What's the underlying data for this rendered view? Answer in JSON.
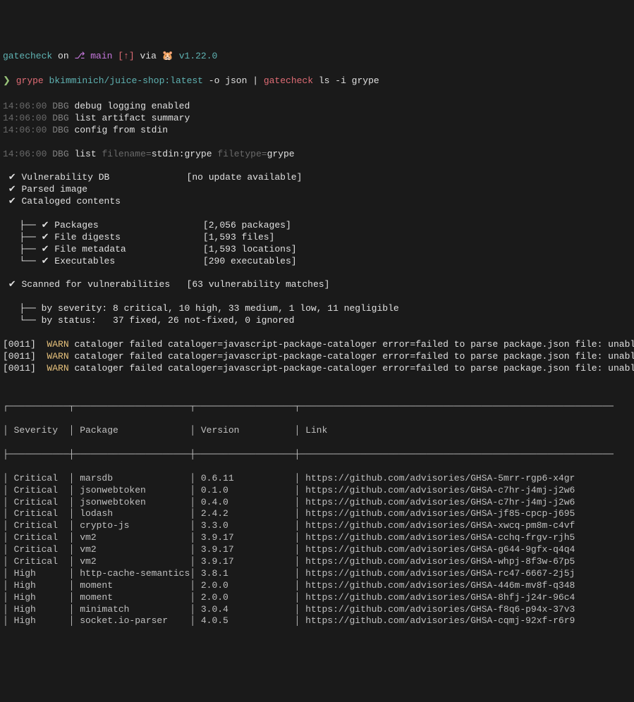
{
  "prompt": {
    "project": "gatecheck",
    "on": "on",
    "branch_icon": "⎇",
    "branch": "main",
    "branch_status": "[↑]",
    "via": "via",
    "lang_icon": "🐹",
    "version": "v1.22.0",
    "prompt_char": "❯",
    "cmd_grype": "grype",
    "cmd_image": "bkimminich/juice-shop:latest",
    "cmd_opts": "-o json |",
    "cmd_gatecheck": "gatecheck",
    "cmd_tail": "ls -i grype"
  },
  "debug": [
    {
      "ts": "14:06:00",
      "tag": "DBG",
      "msg": "debug logging enabled"
    },
    {
      "ts": "14:06:00",
      "tag": "DBG",
      "msg": "list artifact summary"
    },
    {
      "ts": "14:06:00",
      "tag": "DBG",
      "msg": "config from stdin"
    }
  ],
  "list_line": {
    "ts": "14:06:00",
    "tag": "DBG",
    "action": "list",
    "filename_key": "filename=",
    "filename_val": "stdin:grype",
    "filetype_key": "filetype=",
    "filetype_val": "grype"
  },
  "steps": [
    {
      "check": "✔",
      "label": "Vulnerability DB",
      "right": "[no update available]"
    },
    {
      "check": "✔",
      "label": "Parsed image",
      "right": ""
    },
    {
      "check": "✔",
      "label": "Cataloged contents",
      "right": ""
    }
  ],
  "catalog_items": [
    {
      "prefix": "├──",
      "check": "✔",
      "label": "Packages",
      "right": "[2,056 packages]"
    },
    {
      "prefix": "├──",
      "check": "✔",
      "label": "File digests",
      "right": "[1,593 files]"
    },
    {
      "prefix": "├──",
      "check": "✔",
      "label": "File metadata",
      "right": "[1,593 locations]"
    },
    {
      "prefix": "└──",
      "check": "✔",
      "label": "Executables",
      "right": "[290 executables]"
    }
  ],
  "scanned": {
    "check": "✔",
    "label": "Scanned for vulnerabilities",
    "right": "[63 vulnerability matches]"
  },
  "scan_details": [
    {
      "prefix": "├──",
      "text": "by severity: 8 critical, 10 high, 33 medium, 1 low, 11 negligible"
    },
    {
      "prefix": "└──",
      "text": "by status:   37 fixed, 26 not-fixed, 0 ignored"
    }
  ],
  "warnings": [
    {
      "id": "[0011]",
      "level": "WARN",
      "msg": "cataloger failed cataloger=javascript-package-cataloger error=failed to parse package.json file: unable to parse p"
    },
    {
      "id": "[0011]",
      "level": "WARN",
      "msg": "cataloger failed cataloger=javascript-package-cataloger error=failed to parse package.json file: unable to parse p"
    },
    {
      "id": "[0011]",
      "level": "WARN",
      "msg": "cataloger failed cataloger=javascript-package-cataloger error=failed to parse package.json file: unable to parse p"
    }
  ],
  "table": {
    "headers": {
      "severity": "Severity",
      "package": "Package",
      "version": "Version",
      "link": "Link"
    },
    "rows": [
      {
        "severity": "Critical",
        "package": "marsdb",
        "version": "0.6.11",
        "link": "https://github.com/advisories/GHSA-5mrr-rgp6-x4gr"
      },
      {
        "severity": "Critical",
        "package": "jsonwebtoken",
        "version": "0.1.0",
        "link": "https://github.com/advisories/GHSA-c7hr-j4mj-j2w6"
      },
      {
        "severity": "Critical",
        "package": "jsonwebtoken",
        "version": "0.4.0",
        "link": "https://github.com/advisories/GHSA-c7hr-j4mj-j2w6"
      },
      {
        "severity": "Critical",
        "package": "lodash",
        "version": "2.4.2",
        "link": "https://github.com/advisories/GHSA-jf85-cpcp-j695"
      },
      {
        "severity": "Critical",
        "package": "crypto-js",
        "version": "3.3.0",
        "link": "https://github.com/advisories/GHSA-xwcq-pm8m-c4vf"
      },
      {
        "severity": "Critical",
        "package": "vm2",
        "version": "3.9.17",
        "link": "https://github.com/advisories/GHSA-cchq-frgv-rjh5"
      },
      {
        "severity": "Critical",
        "package": "vm2",
        "version": "3.9.17",
        "link": "https://github.com/advisories/GHSA-g644-9gfx-q4q4"
      },
      {
        "severity": "Critical",
        "package": "vm2",
        "version": "3.9.17",
        "link": "https://github.com/advisories/GHSA-whpj-8f3w-67p5"
      },
      {
        "severity": "High",
        "package": "http-cache-semantics",
        "version": "3.8.1",
        "link": "https://github.com/advisories/GHSA-rc47-6667-2j5j"
      },
      {
        "severity": "High",
        "package": "moment",
        "version": "2.0.0",
        "link": "https://github.com/advisories/GHSA-446m-mv8f-q348"
      },
      {
        "severity": "High",
        "package": "moment",
        "version": "2.0.0",
        "link": "https://github.com/advisories/GHSA-8hfj-j24r-96c4"
      },
      {
        "severity": "High",
        "package": "minimatch",
        "version": "3.0.4",
        "link": "https://github.com/advisories/GHSA-f8q6-p94x-37v3"
      },
      {
        "severity": "High",
        "package": "socket.io-parser",
        "version": "4.0.5",
        "link": "https://github.com/advisories/GHSA-cqmj-92xf-r6r9"
      }
    ]
  }
}
